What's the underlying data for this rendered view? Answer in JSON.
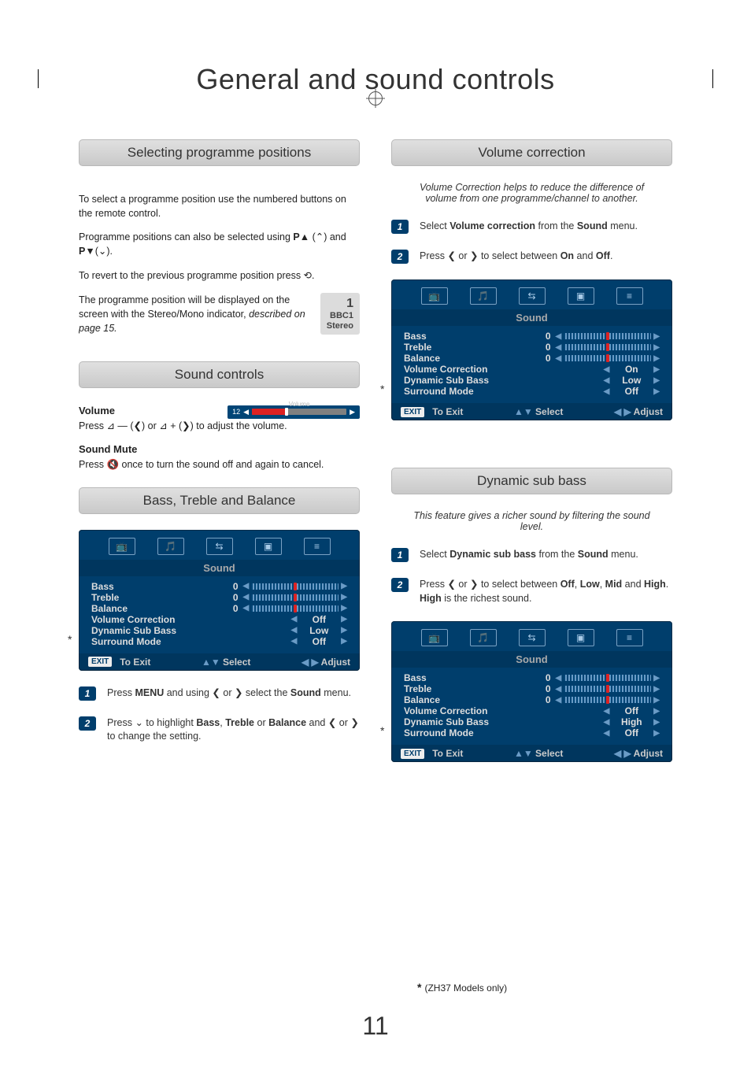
{
  "page_title": "General and sound controls",
  "page_number": "11",
  "footnote": "(ZH37 Models only)",
  "left": {
    "sec1": {
      "header": "Selecting programme positions",
      "p1": "To select a programme position use the numbered buttons on the remote control.",
      "p2_a": "Programme positions can also be selected using ",
      "p2_b": "P▲",
      "p2_c": " (",
      "p2_d": ") and ",
      "p2_e": "P▼",
      "p2_f": "(",
      "p2_g": ").",
      "p3_a": "To revert to the previous programme position press ",
      "p3_b": ".",
      "p4_a": "The programme position will be displayed on the screen with the Stereo/Mono indicator, ",
      "p4_italic": "described on page 15.",
      "badge": {
        "num": "1",
        "line1": "BBC1",
        "line2": "Stereo"
      }
    },
    "sec2": {
      "header": "Sound controls",
      "volume_head": "Volume",
      "volume_a": "Press ",
      "volume_b": " — (",
      "volume_c": ") or ",
      "volume_d": " + (",
      "volume_e": ") to adjust the volume.",
      "mute_head": "Sound Mute",
      "mute_a": "Press ",
      "mute_b": " once to turn the sound off and again to cancel.",
      "vol_bar": {
        "num": "12",
        "label": "Volume"
      }
    },
    "sec3": {
      "header": "Bass, Treble and Balance",
      "osd": {
        "title": "Sound",
        "rows": [
          {
            "label": "Bass",
            "val": "0",
            "type": "slider"
          },
          {
            "label": "Treble",
            "val": "0",
            "type": "slider"
          },
          {
            "label": "Balance",
            "val": "0",
            "type": "slider"
          },
          {
            "label": "Volume Correction",
            "val": "Off",
            "type": "opt"
          },
          {
            "label": "Dynamic Sub Bass",
            "val": "Low",
            "type": "opt"
          },
          {
            "label": "Surround Mode",
            "val": "Off",
            "type": "opt"
          }
        ],
        "exit": "EXIT",
        "f1": "To Exit",
        "f2": "Select",
        "f3": "Adjust"
      },
      "step1_a": "Press ",
      "step1_b": "MENU",
      "step1_c": " and using ",
      "step1_d": " or ",
      "step1_e": " select the ",
      "step1_f": "Sound",
      "step1_g": " menu.",
      "step2_a": "Press ",
      "step2_b": " to highlight ",
      "step2_c": "Bass",
      "step2_d": ", ",
      "step2_e": "Treble",
      "step2_f": " or ",
      "step2_g": "Balance",
      "step2_h": " and ",
      "step2_i": " or ",
      "step2_j": " to change the setting."
    }
  },
  "right": {
    "sec1": {
      "header": "Volume correction",
      "intro": "Volume Correction helps to reduce the difference of volume from one programme/channel to another.",
      "step1_a": "Select ",
      "step1_b": "Volume correction",
      "step1_c": " from the ",
      "step1_d": "Sound",
      "step1_e": " menu.",
      "step2_a": "Press ",
      "step2_b": " or ",
      "step2_c": " to select between ",
      "step2_d": "On",
      "step2_e": " and ",
      "step2_f": "Off",
      "step2_g": ".",
      "osd": {
        "title": "Sound",
        "rows": [
          {
            "label": "Bass",
            "val": "0",
            "type": "slider"
          },
          {
            "label": "Treble",
            "val": "0",
            "type": "slider"
          },
          {
            "label": "Balance",
            "val": "0",
            "type": "slider"
          },
          {
            "label": "Volume Correction",
            "val": "On",
            "type": "opt"
          },
          {
            "label": "Dynamic Sub Bass",
            "val": "Low",
            "type": "opt"
          },
          {
            "label": "Surround Mode",
            "val": "Off",
            "type": "opt"
          }
        ],
        "exit": "EXIT",
        "f1": "To Exit",
        "f2": "Select",
        "f3": "Adjust"
      }
    },
    "sec2": {
      "header": "Dynamic sub bass",
      "intro": "This feature gives a richer sound by filtering the sound level.",
      "step1_a": "Select ",
      "step1_b": "Dynamic sub bass",
      "step1_c": " from the ",
      "step1_d": "Sound",
      "step1_e": " menu.",
      "step2_a": "Press ",
      "step2_b": " or ",
      "step2_c": " to select between ",
      "step2_d": "Off",
      "step2_e": ", ",
      "step2_f": "Low",
      "step2_g": ", ",
      "step2_h": "Mid",
      "step2_i": " and ",
      "step2_j": "High",
      "step2_k": ". ",
      "step2_l": "High",
      "step2_m": " is the richest sound.",
      "osd": {
        "title": "Sound",
        "rows": [
          {
            "label": "Bass",
            "val": "0",
            "type": "slider"
          },
          {
            "label": "Treble",
            "val": "0",
            "type": "slider"
          },
          {
            "label": "Balance",
            "val": "0",
            "type": "slider"
          },
          {
            "label": "Volume Correction",
            "val": "Off",
            "type": "opt"
          },
          {
            "label": "Dynamic Sub Bass",
            "val": "High",
            "type": "opt"
          },
          {
            "label": "Surround Mode",
            "val": "Off",
            "type": "opt"
          }
        ],
        "exit": "EXIT",
        "f1": "To Exit",
        "f2": "Select",
        "f3": "Adjust"
      }
    }
  }
}
